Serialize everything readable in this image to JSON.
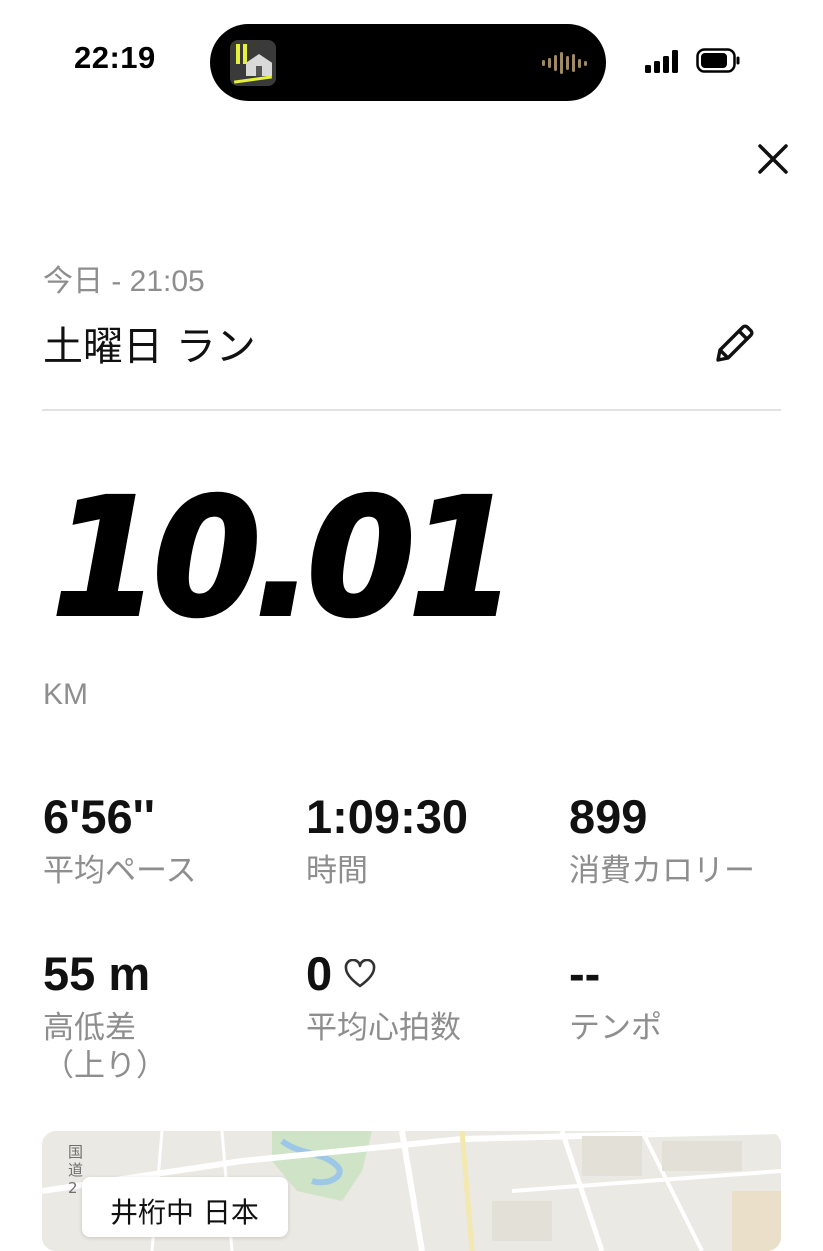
{
  "status_bar": {
    "time": "22:19"
  },
  "workout": {
    "subtitle": "今日 - 21:05",
    "title": "土曜日 ラン",
    "distance": "10.01",
    "distance_unit": "KM"
  },
  "stats": [
    {
      "value": "6'56''",
      "label": "平均ペース"
    },
    {
      "value": "1:09:30",
      "label": "時間"
    },
    {
      "value": "899",
      "label": "消費カロリー"
    },
    {
      "value": "55 m",
      "label": "高低差",
      "label_line2": "（上り）"
    },
    {
      "value": "0",
      "label": "平均心拍数"
    },
    {
      "value": "--",
      "label": "テンポ"
    }
  ],
  "map": {
    "road_label": "国道2",
    "card_text": "井桁中 日本"
  },
  "colors": {
    "text_primary": "#111111",
    "text_secondary": "#8e8e8e",
    "divider": "#e2e2e2",
    "map_background": "#ebe9e3"
  },
  "icons": {
    "close": "close-icon",
    "edit": "pencil-icon",
    "heart": "heart-icon"
  }
}
